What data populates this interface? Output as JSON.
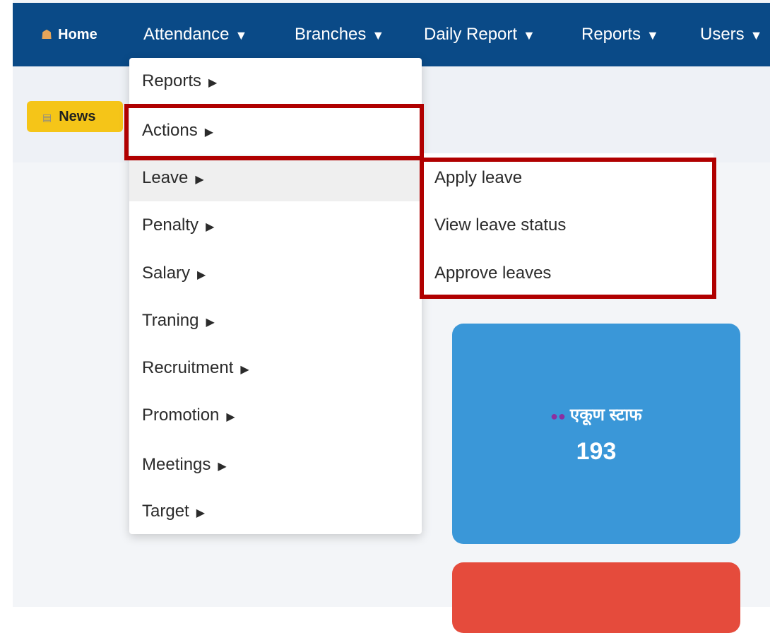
{
  "navbar": {
    "home": {
      "icon": "home-icon",
      "label": "Home"
    },
    "items": [
      {
        "label": "Attendance",
        "caret": "▼"
      },
      {
        "label": "Branches",
        "caret": "▼"
      },
      {
        "label": "Daily Report",
        "caret": "▼"
      },
      {
        "label": "Reports",
        "caret": "▼"
      },
      {
        "label": "Users",
        "caret": "▼"
      }
    ]
  },
  "news": {
    "icon": "newspaper-icon",
    "label": "News"
  },
  "attendance_menu": {
    "items": [
      {
        "label": "Reports",
        "arrow": "▶"
      },
      {
        "label": "Actions",
        "arrow": "▶"
      },
      {
        "label": "Leave",
        "arrow": "▶"
      },
      {
        "label": "Penalty",
        "arrow": "▶"
      },
      {
        "label": "Salary",
        "arrow": "▶"
      },
      {
        "label": "Traning",
        "arrow": "▶"
      },
      {
        "label": "Recruitment",
        "arrow": "▶"
      },
      {
        "label": "Promotion",
        "arrow": "▶"
      },
      {
        "label": "Meetings",
        "arrow": "▶"
      },
      {
        "label": "Target",
        "arrow": "▶"
      }
    ],
    "active_item": "Leave"
  },
  "leave_submenu": {
    "items": [
      {
        "label": "Apply leave"
      },
      {
        "label": "View leave status"
      },
      {
        "label": "Approve leaves"
      }
    ]
  },
  "stats": {
    "total_staff": {
      "icon": "people-icon",
      "label": "एकूण स्टाफ",
      "value": "193",
      "color": "#3a97d8"
    },
    "second_card": {
      "color": "#e54b3c"
    }
  },
  "colors": {
    "navbar": "#0a4a87",
    "news_badge": "#f5c518",
    "highlight": "#b00000"
  }
}
